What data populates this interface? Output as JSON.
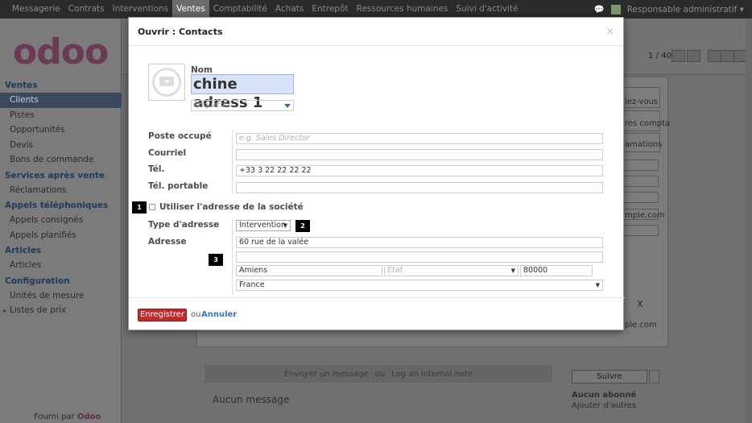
{
  "topmenu": {
    "items": [
      "Messagerie",
      "Contrats",
      "Interventions",
      "Ventes",
      "Comptabilité",
      "Achats",
      "Entrepôt",
      "Ressources humaines",
      "Suivi d'activité"
    ],
    "active": "Ventes",
    "user": "Responsable administratif"
  },
  "logo": "odoo",
  "sidebar": {
    "sections": [
      {
        "title": "Ventes",
        "items": [
          "Clients",
          "Pistes",
          "Opportunités",
          "Devis",
          "Bons de commande"
        ]
      },
      {
        "title": "Services après vente",
        "items": [
          "Réclamations"
        ]
      },
      {
        "title": "Appels téléphoniques",
        "items": [
          "Appels consignés",
          "Appels planifiés"
        ]
      },
      {
        "title": "Articles",
        "items": [
          "Articles"
        ]
      },
      {
        "title": "Configuration",
        "items": [
          "Unités de mesure",
          "Listes de prix"
        ]
      }
    ],
    "active_item": "Clients",
    "footer_prefix": "Fourni par",
    "footer_brand": "Odoo"
  },
  "background": {
    "pager": "1 / 40",
    "side_buttons": [
      "lez-vous",
      "res compta",
      "amations"
    ],
    "email_fragment": "mple.com",
    "email_fragment2": "ple.com",
    "x_mark": "X",
    "chatter": {
      "send": "Envoyer un message",
      "or": "ou",
      "log": "Log an internal note"
    },
    "no_message": "Aucun message",
    "follow": "Suivre",
    "no_follower": "Aucun abonné",
    "add_followers": "Ajouter d'autres"
  },
  "dialog": {
    "title": "Ouvrir : Contacts",
    "close": "×",
    "name_label": "Nom",
    "name_value": "chine adress 1",
    "tags_placeholder": "Étiquettes...",
    "fields": {
      "function_label": "Poste occupé",
      "function_placeholder": "e.g. Sales Director",
      "email_label": "Courriel",
      "email_value": "",
      "phone_label": "Tél.",
      "phone_value": "+33 3 22 22 22 22",
      "mobile_label": "Tél. portable",
      "mobile_value": ""
    },
    "use_company_address": "Utiliser l'adresse de la société",
    "address_type_label": "Type d'adresse",
    "address_type_value": "Intervention",
    "address_label": "Adresse",
    "street": "60 rue de la valée",
    "street2": "",
    "city": "Amiens",
    "state_placeholder": "État",
    "zip": "80000",
    "country": "France",
    "badges": [
      "1",
      "2",
      "3"
    ],
    "save": "Enregistrer",
    "or": "ou",
    "cancel": "Annuler"
  },
  "colors": {
    "save": "#c02a2a",
    "link": "#3a75b5",
    "name_highlight": "#d6e2f8",
    "brand": "#6b3a56"
  }
}
